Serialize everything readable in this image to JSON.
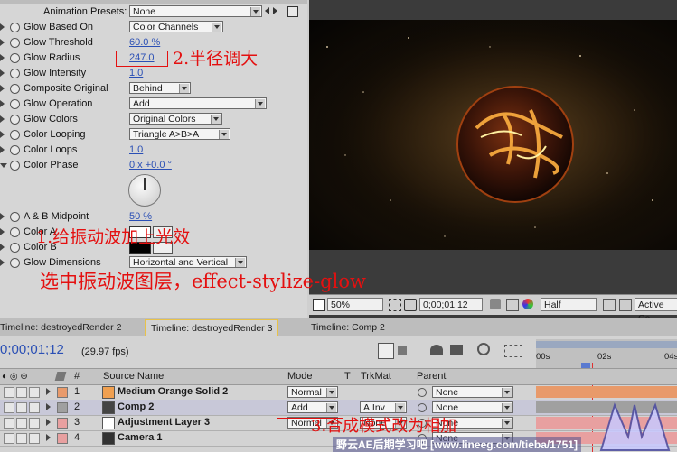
{
  "effect_controls": {
    "animation_presets_label": "Animation Presets:",
    "animation_presets_value": "None",
    "rows": [
      {
        "label": "Glow Based On",
        "value": "Color Channels",
        "kind": "dropdown"
      },
      {
        "label": "Glow Threshold",
        "value": "60.0 %",
        "kind": "value"
      },
      {
        "label": "Glow Radius",
        "value": "247.0",
        "kind": "value"
      },
      {
        "label": "Glow Intensity",
        "value": "1.0",
        "kind": "value"
      },
      {
        "label": "Composite Original",
        "value": "Behind",
        "kind": "dropdown"
      },
      {
        "label": "Glow Operation",
        "value": "Add",
        "kind": "dropdown"
      },
      {
        "label": "Glow Colors",
        "value": "Original Colors",
        "kind": "dropdown"
      },
      {
        "label": "Color Looping",
        "value": "Triangle A>B>A",
        "kind": "dropdown"
      },
      {
        "label": "Color Loops",
        "value": "1.0",
        "kind": "value"
      },
      {
        "label": "Color Phase",
        "value": "0 x +0.0 °",
        "kind": "value"
      }
    ],
    "rows2": [
      {
        "label": "A & B Midpoint",
        "value": "50 %",
        "kind": "value"
      },
      {
        "label": "Color A",
        "value": "",
        "kind": "swatch"
      },
      {
        "label": "Color B",
        "value": "",
        "kind": "swatch"
      },
      {
        "label": "Glow Dimensions",
        "value": "Horizontal and Vertical",
        "kind": "dropdown"
      }
    ]
  },
  "annotations": {
    "radius": "2.半径调大",
    "step1": "1.给振动波加上光效",
    "step1_sub": "选中振动波图层，effect-stylize-glow",
    "step3": "3.合成模式改为相加"
  },
  "viewer": {
    "zoom": "50%",
    "timecode": "0;00;01;12",
    "resolution": "Half",
    "camera": "Active Ca"
  },
  "tabs": [
    {
      "label": "Timeline: destroyedRender 2",
      "active": false
    },
    {
      "label": "Timeline: destroyedRender 3",
      "active": true
    },
    {
      "label": "Timeline: Comp 2",
      "active": false
    }
  ],
  "timeline": {
    "timecode": "0;00;01;12",
    "fps": "(29.97 fps)",
    "headers": {
      "source": "Source Name",
      "mode": "Mode",
      "t": "T",
      "trkmat": "TrkMat",
      "parent": "Parent",
      "hash": "#"
    },
    "ruler": [
      "00s",
      "02s",
      "04s"
    ],
    "layers": [
      {
        "num": "1",
        "name": "Medium Orange Solid 2",
        "mode": "Normal",
        "trkmat": "",
        "parent": "None",
        "color": "#e89a6a",
        "icon": "#f0a050"
      },
      {
        "num": "2",
        "name": "Comp 2",
        "mode": "Add",
        "trkmat": "A.Inv",
        "parent": "None",
        "color": "#a0a0a0",
        "icon": "#444444"
      },
      {
        "num": "3",
        "name": "Adjustment Layer 3",
        "mode": "Normal",
        "trkmat": "None",
        "parent": "None",
        "color": "#e8a0a0",
        "icon": "#ffffff"
      },
      {
        "num": "4",
        "name": "Camera 1",
        "mode": "",
        "trkmat": "",
        "parent": "None",
        "color": "#e8a0a0",
        "icon": "#333333"
      }
    ]
  },
  "watermark": "野云AE后期学习吧 [www.lineeg.com/tieba/1751]"
}
